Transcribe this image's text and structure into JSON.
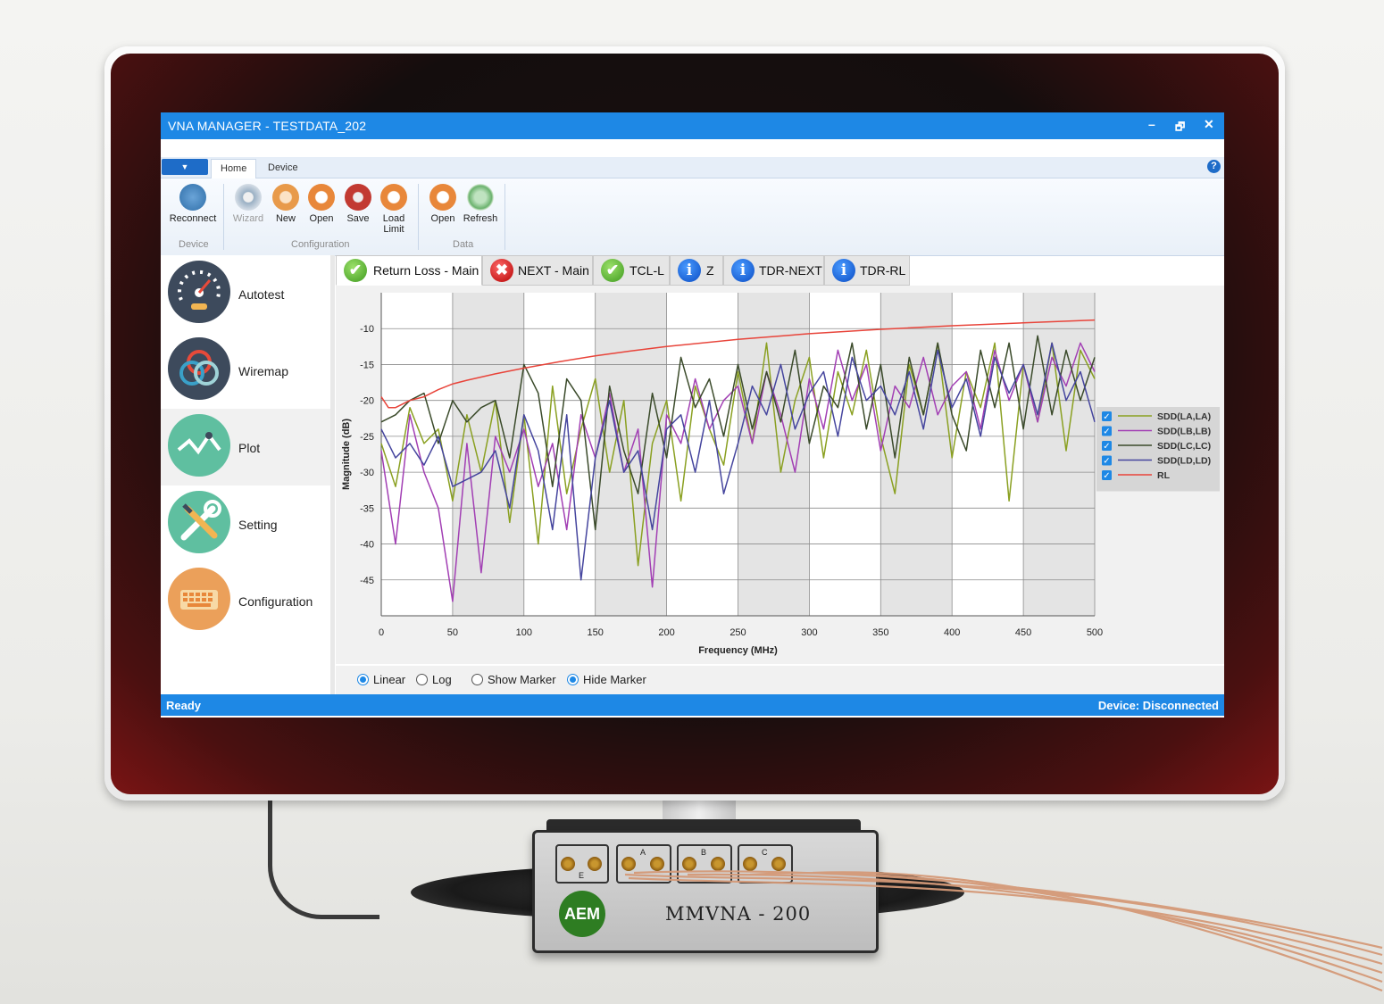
{
  "window": {
    "title": "VNA MANAGER - TESTDATA_202",
    "minimize": "–",
    "restore": "🗗",
    "close": "✕"
  },
  "ribbon": {
    "tabs": [
      "Home",
      "Device"
    ],
    "help": "?",
    "buttons": {
      "reconnect": "Reconnect",
      "wizard": "Wizard",
      "new": "New",
      "open": "Open",
      "save": "Save",
      "load_limit_1": "Load",
      "load_limit_2": "Limit",
      "data_open": "Open",
      "refresh": "Refresh"
    },
    "groups": {
      "device": "Device",
      "configuration": "Configuration",
      "data": "Data"
    }
  },
  "nav": [
    "Autotest",
    "Wiremap",
    "Plot",
    "Setting",
    "Configuration"
  ],
  "plot_tabs": [
    {
      "label": "Return Loss - Main",
      "status": "pass"
    },
    {
      "label": "NEXT - Main",
      "status": "fail"
    },
    {
      "label": "TCL-L",
      "status": "pass"
    },
    {
      "label": "Z",
      "status": "info"
    },
    {
      "label": "TDR-NEXT",
      "status": "info"
    },
    {
      "label": "TDR-RL",
      "status": "info"
    }
  ],
  "chart_data": {
    "type": "line",
    "xlabel": "Frequency (MHz)",
    "ylabel": "Magnitude (dB)",
    "xlim": [
      0,
      500
    ],
    "ylim": [
      -50,
      -5
    ],
    "xticks": [
      0,
      50,
      100,
      150,
      200,
      250,
      300,
      350,
      400,
      450,
      500
    ],
    "yticks": [
      -10,
      -15,
      -20,
      -25,
      -30,
      -35,
      -40,
      -45
    ],
    "grid": true,
    "legend": "right",
    "series": [
      {
        "name": "SDD(LA,LA)",
        "color": "#8aa021",
        "x": [
          0,
          10,
          20,
          30,
          40,
          50,
          60,
          70,
          80,
          90,
          100,
          110,
          120,
          130,
          140,
          150,
          160,
          170,
          180,
          190,
          200,
          210,
          220,
          230,
          240,
          250,
          260,
          270,
          280,
          290,
          300,
          310,
          320,
          330,
          340,
          350,
          360,
          370,
          380,
          390,
          400,
          410,
          420,
          430,
          440,
          450,
          460,
          470,
          480,
          490,
          500
        ],
        "y": [
          -26,
          -32,
          -21,
          -26,
          -24,
          -34,
          -22,
          -30,
          -20,
          -37,
          -22,
          -40,
          -18,
          -33,
          -24,
          -17,
          -30,
          -20,
          -43,
          -26,
          -20,
          -34,
          -18,
          -24,
          -29,
          -16,
          -26,
          -12,
          -30,
          -20,
          -14,
          -28,
          -16,
          -22,
          -13,
          -25,
          -33,
          -15,
          -22,
          -12,
          -28,
          -16,
          -21,
          -12,
          -34,
          -15,
          -23,
          -12,
          -27,
          -13,
          -17
        ]
      },
      {
        "name": "SDD(LB,LB)",
        "color": "#a23fb4",
        "x": [
          0,
          10,
          20,
          30,
          40,
          50,
          60,
          70,
          80,
          90,
          100,
          110,
          120,
          130,
          140,
          150,
          160,
          170,
          180,
          190,
          200,
          210,
          220,
          230,
          240,
          250,
          260,
          270,
          280,
          290,
          300,
          310,
          320,
          330,
          340,
          350,
          360,
          370,
          380,
          390,
          400,
          410,
          420,
          430,
          440,
          450,
          460,
          470,
          480,
          490,
          500
        ],
        "y": [
          -27,
          -40,
          -22,
          -30,
          -35,
          -48,
          -26,
          -44,
          -25,
          -30,
          -24,
          -32,
          -26,
          -38,
          -22,
          -28,
          -19,
          -30,
          -24,
          -46,
          -22,
          -26,
          -17,
          -24,
          -20,
          -18,
          -26,
          -16,
          -22,
          -30,
          -17,
          -24,
          -13,
          -20,
          -15,
          -27,
          -18,
          -21,
          -14,
          -22,
          -18,
          -16,
          -24,
          -13,
          -20,
          -15,
          -23,
          -14,
          -18,
          -12,
          -16
        ]
      },
      {
        "name": "SDD(LC,LC)",
        "color": "#3a4a2a",
        "x": [
          0,
          10,
          20,
          30,
          40,
          50,
          60,
          70,
          80,
          90,
          100,
          110,
          120,
          130,
          140,
          150,
          160,
          170,
          180,
          190,
          200,
          210,
          220,
          230,
          240,
          250,
          260,
          270,
          280,
          290,
          300,
          310,
          320,
          330,
          340,
          350,
          360,
          370,
          380,
          390,
          400,
          410,
          420,
          430,
          440,
          450,
          460,
          470,
          480,
          490,
          500
        ],
        "y": [
          -23,
          -22,
          -20,
          -19,
          -26,
          -20,
          -23,
          -21,
          -20,
          -28,
          -15,
          -19,
          -32,
          -17,
          -20,
          -38,
          -18,
          -27,
          -33,
          -19,
          -28,
          -14,
          -21,
          -17,
          -25,
          -15,
          -24,
          -16,
          -23,
          -13,
          -26,
          -18,
          -21,
          -12,
          -24,
          -15,
          -28,
          -14,
          -22,
          -12,
          -22,
          -27,
          -13,
          -21,
          -12,
          -24,
          -11,
          -22,
          -13,
          -20,
          -14
        ]
      },
      {
        "name": "SDD(LD,LD)",
        "color": "#45459e",
        "x": [
          0,
          10,
          20,
          30,
          40,
          50,
          60,
          70,
          80,
          90,
          100,
          110,
          120,
          130,
          140,
          150,
          160,
          170,
          180,
          190,
          200,
          210,
          220,
          230,
          240,
          250,
          260,
          270,
          280,
          290,
          300,
          310,
          320,
          330,
          340,
          350,
          360,
          370,
          380,
          390,
          400,
          410,
          420,
          430,
          440,
          450,
          460,
          470,
          480,
          490,
          500
        ],
        "y": [
          -24,
          -28,
          -26,
          -29,
          -25,
          -32,
          -31,
          -30,
          -27,
          -35,
          -22,
          -27,
          -38,
          -22,
          -45,
          -28,
          -20,
          -30,
          -27,
          -38,
          -24,
          -22,
          -30,
          -20,
          -33,
          -26,
          -18,
          -22,
          -15,
          -24,
          -19,
          -16,
          -25,
          -14,
          -20,
          -18,
          -22,
          -16,
          -24,
          -13,
          -21,
          -17,
          -25,
          -14,
          -19,
          -15,
          -22,
          -12,
          -20,
          -16,
          -23
        ]
      },
      {
        "name": "RL",
        "color": "#e8443a",
        "x": [
          0,
          5,
          10,
          20,
          30,
          40,
          50,
          60,
          80,
          100,
          125,
          150,
          175,
          200,
          250,
          300,
          350,
          400,
          450,
          500
        ],
        "y": [
          -19.5,
          -21,
          -21,
          -20,
          -19.5,
          -18.5,
          -17.7,
          -17.2,
          -16.3,
          -15.5,
          -14.6,
          -13.8,
          -13.1,
          -12.5,
          -11.5,
          -10.7,
          -10.1,
          -9.6,
          -9.2,
          -8.8
        ]
      }
    ]
  },
  "controls": {
    "linear": "Linear",
    "log": "Log",
    "show_marker": "Show Marker",
    "hide_marker": "Hide Marker"
  },
  "status": {
    "left": "Ready",
    "right": "Device: Disconnected"
  },
  "hardware": {
    "brand": "AEM",
    "model": "MMVNA - 200",
    "ports": [
      "A",
      "B",
      "C"
    ],
    "port_e": "E"
  },
  "colors": {
    "titlebar": "#1e88e5",
    "pass": "#3e9a1e",
    "fail": "#b40000",
    "info": "#0a4cc4"
  }
}
